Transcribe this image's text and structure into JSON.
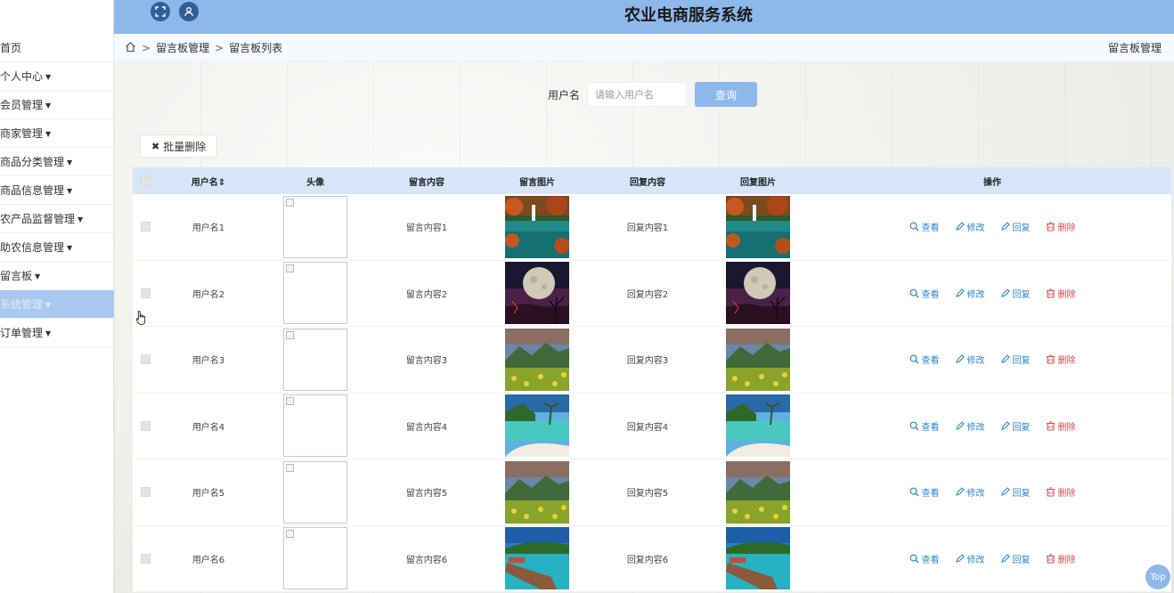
{
  "header": {
    "title": "农业电商服务系统"
  },
  "sidebar": {
    "items": [
      {
        "label": "首页",
        "caret": false,
        "active": false
      },
      {
        "label": "个人中心",
        "caret": true,
        "active": false
      },
      {
        "label": "会员管理",
        "caret": true,
        "active": false
      },
      {
        "label": "商家管理",
        "caret": true,
        "active": false
      },
      {
        "label": "商品分类管理",
        "caret": true,
        "active": false
      },
      {
        "label": "商品信息管理",
        "caret": true,
        "active": false
      },
      {
        "label": "农产品监督管理",
        "caret": true,
        "active": false
      },
      {
        "label": "助农信息管理",
        "caret": true,
        "active": false
      },
      {
        "label": "留言板",
        "caret": true,
        "active": false
      },
      {
        "label": "系统管理",
        "caret": true,
        "active": true
      },
      {
        "label": "订单管理",
        "caret": true,
        "active": false
      }
    ]
  },
  "breadcrumb": {
    "sep": ">",
    "level1": "留言板管理",
    "level2": "留言板列表",
    "right": "留言板管理"
  },
  "search": {
    "label": "用户名",
    "placeholder": "请输入用户名",
    "button": "查询"
  },
  "toolbar": {
    "batch_delete": "批量删除"
  },
  "table": {
    "headers": {
      "username": "用户名",
      "avatar": "头像",
      "message": "留言内容",
      "message_image": "留言图片",
      "reply": "回复内容",
      "reply_image": "回复图片",
      "ops": "操作"
    },
    "ops": {
      "view": "查看",
      "edit": "修改",
      "reply": "回复",
      "delete": "删除"
    },
    "rows": [
      {
        "username": "用户名1",
        "message": "留言内容1",
        "reply": "回复内容1",
        "scene": "lake"
      },
      {
        "username": "用户名2",
        "message": "留言内容2",
        "reply": "回复内容2",
        "scene": "moon"
      },
      {
        "username": "用户名3",
        "message": "留言内容3",
        "reply": "回复内容3",
        "scene": "meadow"
      },
      {
        "username": "用户名4",
        "message": "留言内容4",
        "reply": "回复内容4",
        "scene": "beach"
      },
      {
        "username": "用户名5",
        "message": "留言内容5",
        "reply": "回复内容5",
        "scene": "meadow"
      },
      {
        "username": "用户名6",
        "message": "留言内容6",
        "reply": "回复内容6",
        "scene": "pier"
      }
    ]
  },
  "top_button": "Top",
  "colors": {
    "accent": "#8fb8ea",
    "header_row": "#d6e6f8",
    "delete": "#d94b4b",
    "link": "#2a86d0"
  }
}
